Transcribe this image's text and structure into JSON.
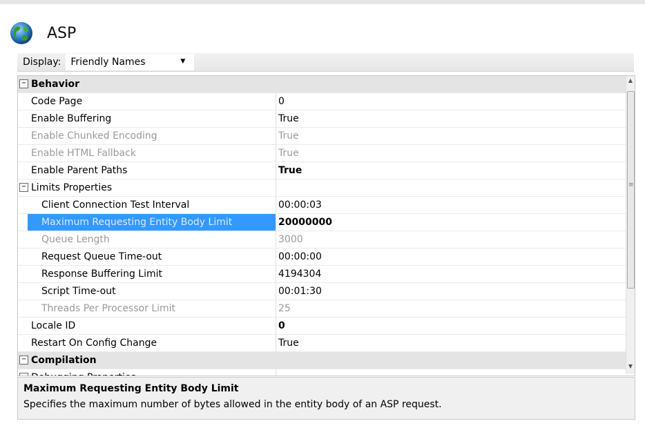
{
  "header": {
    "title": "ASP",
    "icon": "globe-icon"
  },
  "toolbar": {
    "display_label": "Display:",
    "display_value": "Friendly Names"
  },
  "grid": {
    "rows": [
      {
        "kind": "category",
        "name": "Behavior",
        "value": ""
      },
      {
        "kind": "prop",
        "name": "Code Page",
        "value": "0"
      },
      {
        "kind": "prop",
        "name": "Enable Buffering",
        "value": "True"
      },
      {
        "kind": "prop",
        "name": "Enable Chunked Encoding",
        "value": "True",
        "disabled": true
      },
      {
        "kind": "prop",
        "name": "Enable HTML Fallback",
        "value": "True",
        "disabled": true
      },
      {
        "kind": "prop",
        "name": "Enable Parent Paths",
        "value": "True",
        "bold": true
      },
      {
        "kind": "subcategory",
        "name": "Limits Properties",
        "value": ""
      },
      {
        "kind": "subprop",
        "name": "Client Connection Test Interval",
        "value": "00:00:03"
      },
      {
        "kind": "subprop",
        "name": "Maximum Requesting Entity Body Limit",
        "value": "20000000",
        "bold": true,
        "selected": true
      },
      {
        "kind": "subprop",
        "name": "Queue Length",
        "value": "3000",
        "disabled": true
      },
      {
        "kind": "subprop",
        "name": "Request Queue Time-out",
        "value": "00:00:00"
      },
      {
        "kind": "subprop",
        "name": "Response Buffering Limit",
        "value": "4194304"
      },
      {
        "kind": "subprop",
        "name": "Script Time-out",
        "value": "00:01:30"
      },
      {
        "kind": "subprop",
        "name": "Threads Per Processor Limit",
        "value": "25",
        "disabled": true
      },
      {
        "kind": "prop",
        "name": "Locale ID",
        "value": "0",
        "bold": true
      },
      {
        "kind": "prop",
        "name": "Restart On Config Change",
        "value": "True"
      },
      {
        "kind": "category",
        "name": "Compilation",
        "value": ""
      },
      {
        "kind": "subcategory",
        "name": "Debugging Properties",
        "value": ""
      }
    ]
  },
  "description": {
    "title": "Maximum Requesting Entity Body Limit",
    "text": "Specifies the maximum number of bytes allowed in the entity body of an ASP request."
  },
  "colors": {
    "selection": "#3399ff",
    "category_bg": "#e4e4e4",
    "disabled_text": "#9a9a9a"
  }
}
